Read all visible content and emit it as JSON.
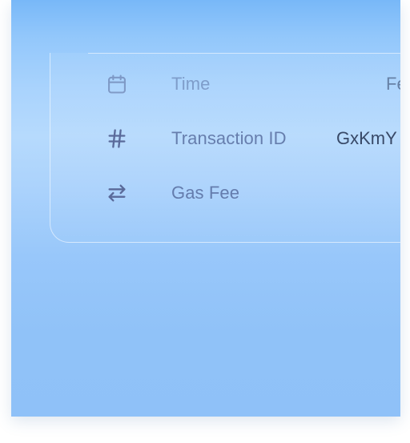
{
  "details": {
    "rows": [
      {
        "icon": "calendar-icon",
        "label": "Time",
        "value": "Fe"
      },
      {
        "icon": "hash-icon",
        "label": "Transaction ID",
        "value": "GxKmY"
      },
      {
        "icon": "swap-arrows-icon",
        "label": "Gas Fee",
        "value": ""
      }
    ]
  },
  "colors": {
    "background_top": "#78b8f8",
    "background_mid": "#b6dafd",
    "background_bottom": "#8fc1f8",
    "label_text": "#5064a0",
    "value_text": "#263452",
    "icon_color": "#5a6a9a"
  }
}
